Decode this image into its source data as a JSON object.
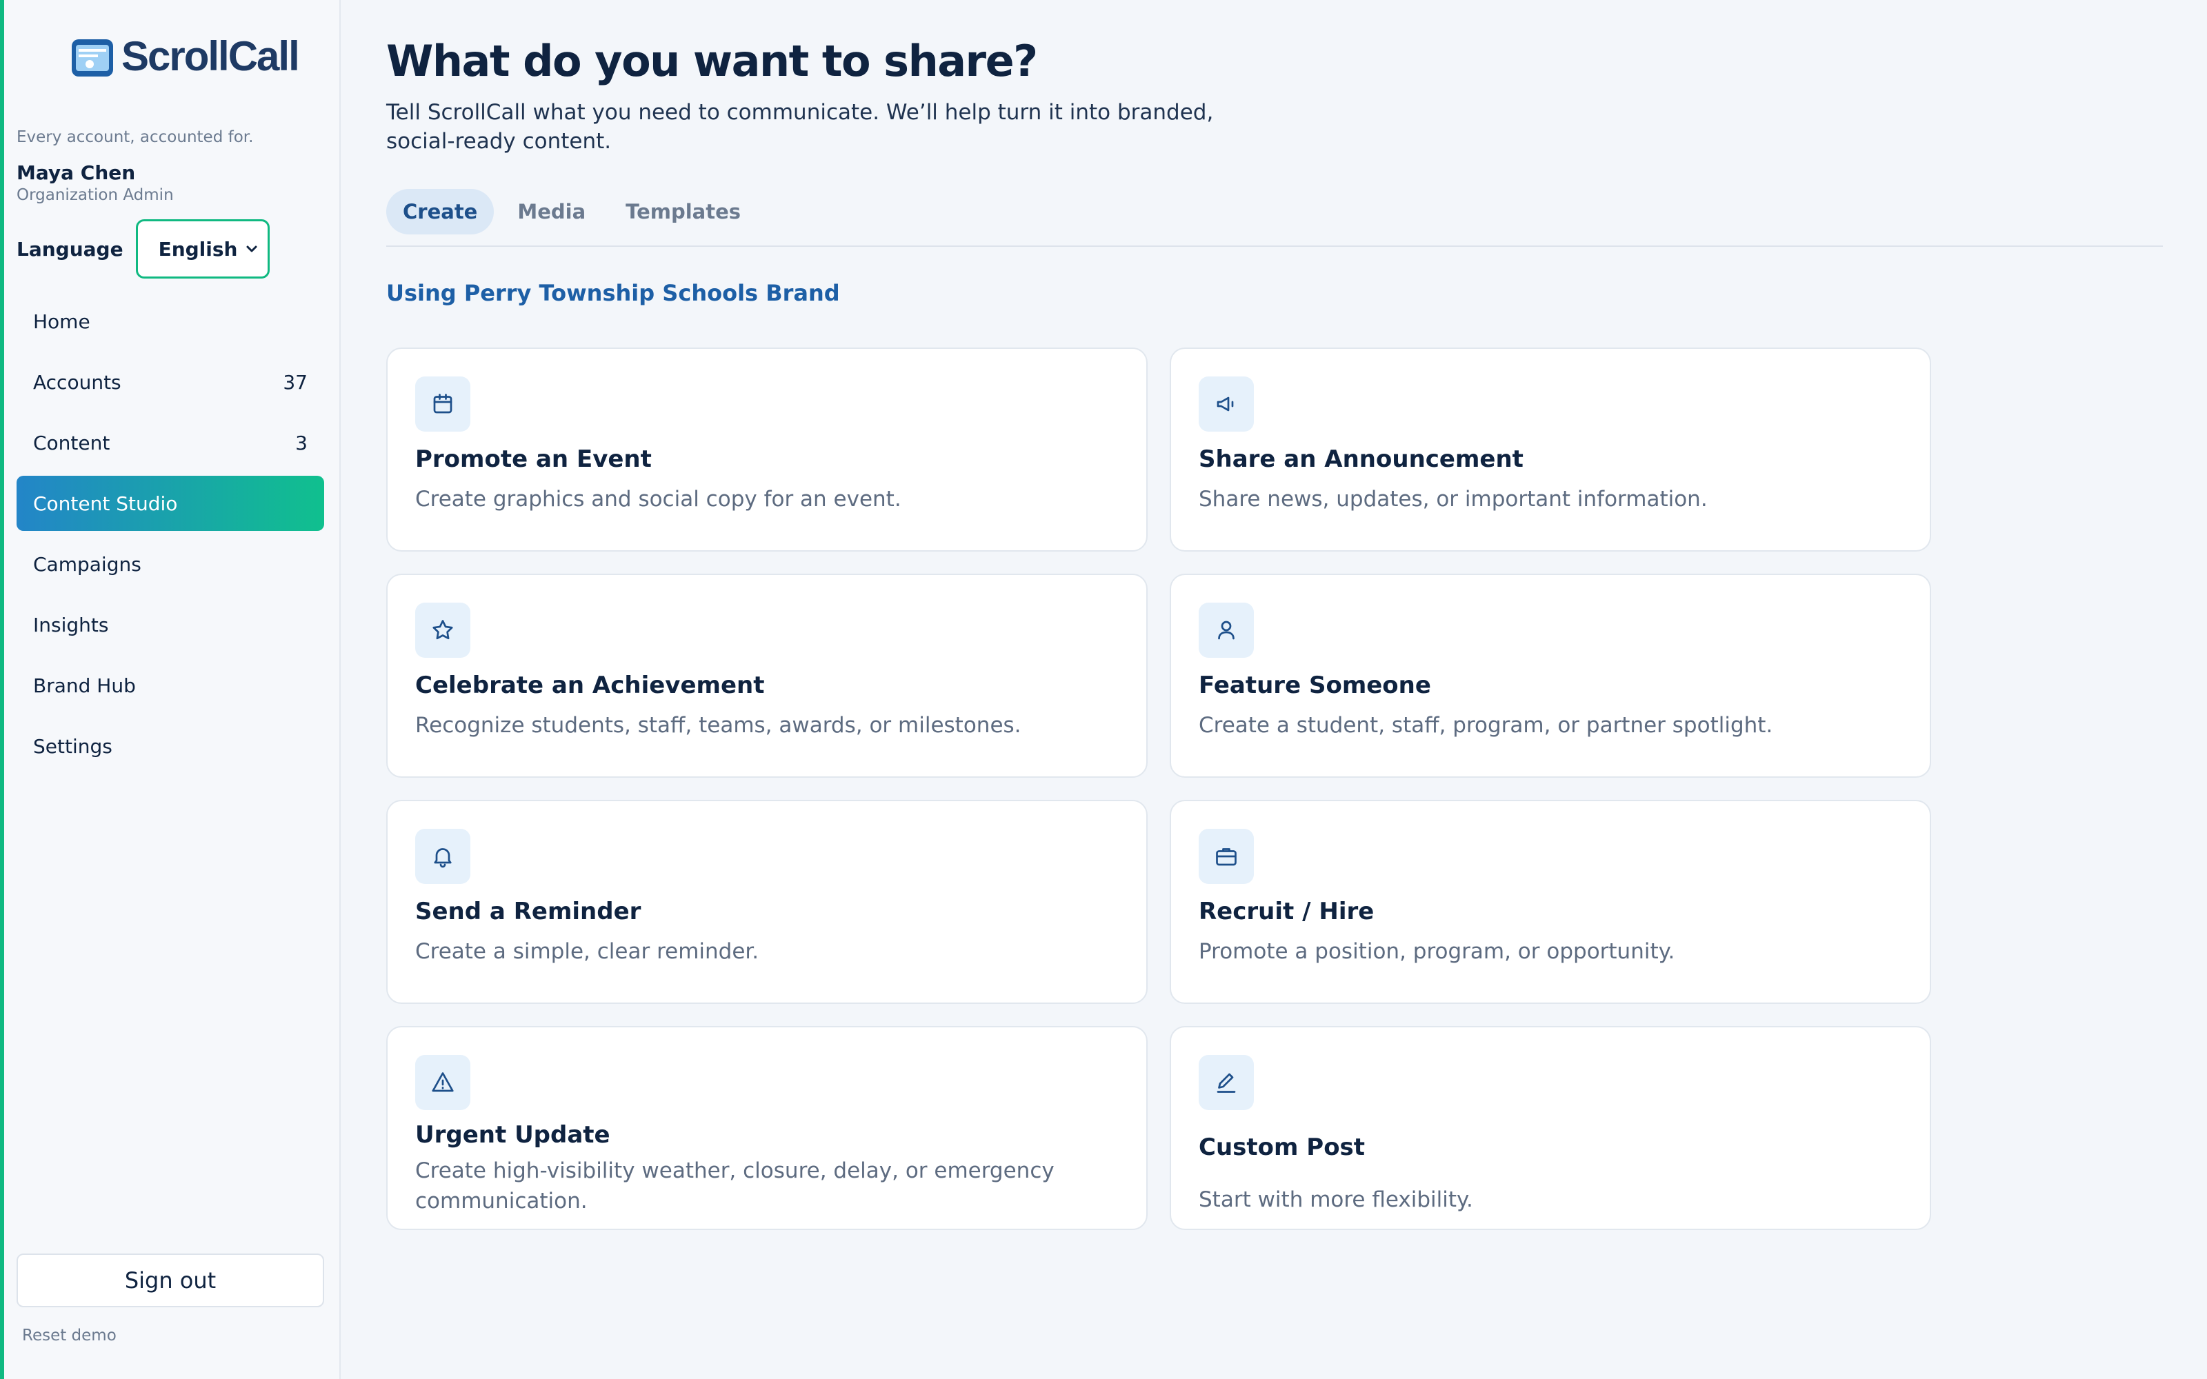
{
  "app": {
    "logo_text": "ScrollCall",
    "tagline": "Every account, accounted for.",
    "accent": "#10b981",
    "primary": "#1d5fa6"
  },
  "user": {
    "name": "Maya Chen",
    "role": "Organization Admin"
  },
  "language": {
    "label": "Language",
    "selected": "English"
  },
  "sidebar": {
    "items": [
      {
        "label": "Home",
        "count": ""
      },
      {
        "label": "Accounts",
        "count": "37"
      },
      {
        "label": "Content",
        "count": "3"
      },
      {
        "label": "Content Studio",
        "count": "",
        "active": true
      },
      {
        "label": "Campaigns",
        "count": ""
      },
      {
        "label": "Insights",
        "count": ""
      },
      {
        "label": "Brand Hub",
        "count": ""
      },
      {
        "label": "Settings",
        "count": ""
      }
    ],
    "sign_out": "Sign out",
    "reset": "Reset demo"
  },
  "main": {
    "title": "What do you want to share?",
    "subtitle": "Tell ScrollCall what you need to communicate. We’ll help turn it into branded, social-ready content.",
    "tabs": [
      {
        "label": "Create",
        "active": true
      },
      {
        "label": "Media"
      },
      {
        "label": "Templates"
      }
    ],
    "brand_line": "Using Perry Township Schools Brand",
    "cards": [
      {
        "icon": "calendar-icon",
        "title": "Promote an Event",
        "desc": "Create graphics and social copy for an event."
      },
      {
        "icon": "megaphone-icon",
        "title": "Share an Announcement",
        "desc": "Share news, updates, or important information."
      },
      {
        "icon": "star-icon",
        "title": "Celebrate an Achievement",
        "desc": "Recognize students, staff, teams, awards, or milestones."
      },
      {
        "icon": "person-icon",
        "title": "Feature Someone",
        "desc": "Create a student, staff, program, or partner spotlight."
      },
      {
        "icon": "bell-icon",
        "title": "Send a Reminder",
        "desc": "Create a simple, clear reminder."
      },
      {
        "icon": "briefcase-icon",
        "title": "Recruit / Hire",
        "desc": "Promote a position, program, or opportunity."
      },
      {
        "icon": "warning-icon",
        "title": "Urgent Update",
        "desc": "Create high-visibility weather, closure, delay, or emergency communication."
      },
      {
        "icon": "pencil-icon",
        "title": "Custom Post",
        "desc": "Start with more flexibility."
      }
    ]
  }
}
